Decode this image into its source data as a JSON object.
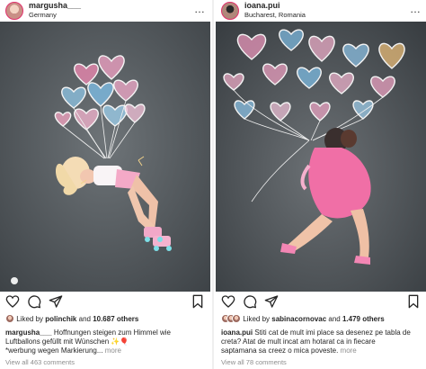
{
  "posts": [
    {
      "username": "margusha___",
      "location": "Germany",
      "liked_prefix": "Liked by ",
      "liked_by": "polinchik",
      "liked_and": " and ",
      "liked_others": "10.687 others",
      "caption_user": "margusha___",
      "caption_line1": "Hoffnungen steigen zum Himmel wie",
      "caption_line2": "Luftballons gefüllt mit Wünschen",
      "caption_line3": "*werbung wegen Markierung...",
      "more_label": "more",
      "view_all": "View all 463 comments",
      "photo_desc": "chalk-balloons-girl-rollerskates"
    },
    {
      "username": "ioana.pui",
      "location": "Bucharest, Romania",
      "liked_prefix": "Liked by ",
      "liked_by": "sabinacornovac",
      "liked_and": " and ",
      "liked_others": "1.479 others",
      "caption_user": "ioana.pui",
      "caption_line1": "Stiti cat de mult imi place sa desenez pe tabla de",
      "caption_line2": "creta? Atat de mult incat am hotarat ca in fiecare",
      "caption_line3": "saptamana sa creez o mica poveste.",
      "more_label": "more",
      "view_all": "View all 78 comments",
      "photo_desc": "chalk-heart-balloons-girl-pink-dress"
    }
  ],
  "icons": {
    "more": "…",
    "like": "heart-icon",
    "comment": "comment-icon",
    "share": "share-icon",
    "save": "bookmark-icon"
  }
}
